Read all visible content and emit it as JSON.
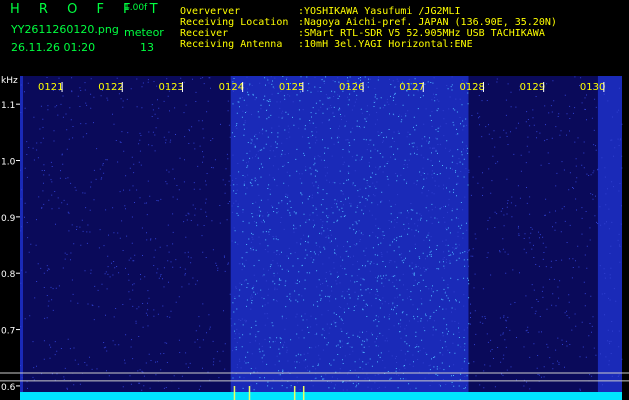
{
  "app": {
    "title": "H R O F F T",
    "version": "1.00f",
    "filename": "YY2611260120.png",
    "datetime": "26.11.26 01:20",
    "mode_label": "meteor",
    "count": "13"
  },
  "station_info": [
    {
      "key": "Oververver",
      "value": ":YOSHIKAWA Yasufumi /JG2MLI"
    },
    {
      "key": "Receiving Location",
      "value": ":Nagoya Aichi-pref. JAPAN (136.90E, 35.20N)"
    },
    {
      "key": "Receiver",
      "value": ":SMart RTL-SDR V5 52.905MHz USB TACHIKAWA"
    },
    {
      "key": "Receiving Antenna",
      "value": ":10mH 3el.YAGI Horizontal:ENE"
    }
  ],
  "colors": {
    "header_green": "#00ff40",
    "info_yellow": "#ffff00",
    "tick_label_yellow": "#ffff00",
    "axis_label_white": "#ffffff",
    "background_noise": "#0a0a5a",
    "bright_noise": "#1a2ab8",
    "speckle": "#4fb7ff",
    "signal_cyan": "#00e5ff",
    "reference_line": "#cccccc"
  },
  "chart_data": {
    "type": "heatmap",
    "ylabel": "kHz",
    "x_tick_labels": [
      "0121",
      "0122",
      "0123",
      "0124",
      "0125",
      "0126",
      "0127",
      "0128",
      "0129",
      "0130"
    ],
    "y_tick_labels": [
      "1.1",
      "1.0",
      "0.9",
      "0.8",
      "0.7",
      "0.6"
    ],
    "y_ticks": [
      1.1,
      1.0,
      0.9,
      0.8,
      0.7,
      0.6
    ],
    "ylim": [
      0.575,
      1.15
    ],
    "xlim_minutes": [
      0,
      10
    ],
    "x_tick_minutes": [
      0.3,
      1.3,
      2.3,
      3.3,
      4.3,
      5.3,
      6.3,
      7.3,
      8.3,
      9.3
    ],
    "reference_lines_khz": [
      0.623,
      0.609
    ],
    "bright_intervals_minutes": [
      [
        3.5,
        7.45
      ]
    ],
    "edge_bright_intervals_minutes": [
      [
        0,
        0.05
      ],
      [
        9.6,
        10
      ]
    ],
    "meteor_spike_minutes": [
      3.55,
      3.8,
      4.55,
      4.7
    ]
  }
}
